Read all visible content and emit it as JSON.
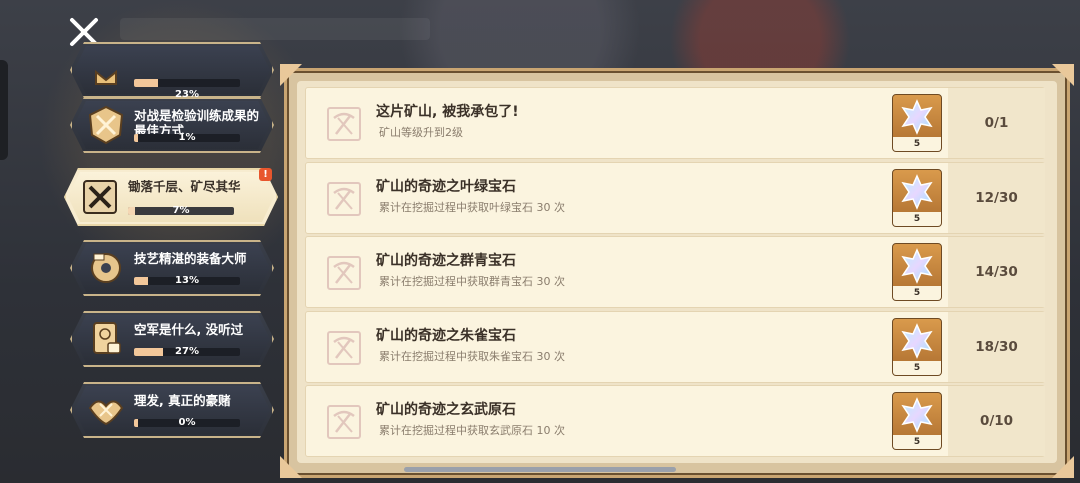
{
  "categories": [
    {
      "title": "",
      "percent_label": "23%",
      "progress": 0.23
    },
    {
      "title": "对战是检验训练成果的最佳方式",
      "percent_label": "1%",
      "progress": 0.01
    },
    {
      "title": "锄落千层、矿尽其华",
      "percent_label": "7%",
      "progress": 0.07,
      "active": true,
      "alert": "!"
    },
    {
      "title": "技艺精湛的装备大师",
      "percent_label": "13%",
      "progress": 0.13
    },
    {
      "title": "空军是什么, 没听过",
      "percent_label": "27%",
      "progress": 0.27
    },
    {
      "title": "理发, 真正的豪赌",
      "percent_label": "0%",
      "progress": 0.0
    }
  ],
  "achievements": [
    {
      "title": "这片矿山, 被我承包了!",
      "desc": "矿山等级升到2级",
      "reward_count": "5",
      "progress": "0/1"
    },
    {
      "title": "矿山的奇迹之叶绿宝石",
      "desc": "累计在挖掘过程中获取叶绿宝石 30 次",
      "reward_count": "5",
      "progress": "12/30"
    },
    {
      "title": "矿山的奇迹之群青宝石",
      "desc": "累计在挖掘过程中获取群青宝石 30 次",
      "reward_count": "5",
      "progress": "14/30"
    },
    {
      "title": "矿山的奇迹之朱雀宝石",
      "desc": "累计在挖掘过程中获取朱雀宝石 30 次",
      "reward_count": "5",
      "progress": "18/30"
    },
    {
      "title": "矿山的奇迹之玄武原石",
      "desc": "累计在挖掘过程中获取玄武原石 10 次",
      "reward_count": "5",
      "progress": "0/10"
    }
  ],
  "icons": {
    "close": "close-x-icon",
    "row": "pickaxe-icon",
    "reward": "star-crystal-icon"
  },
  "colors": {
    "accent_gold": "#c9b48a",
    "progress_fill": "#f2c79a",
    "alert": "#e8562d"
  }
}
